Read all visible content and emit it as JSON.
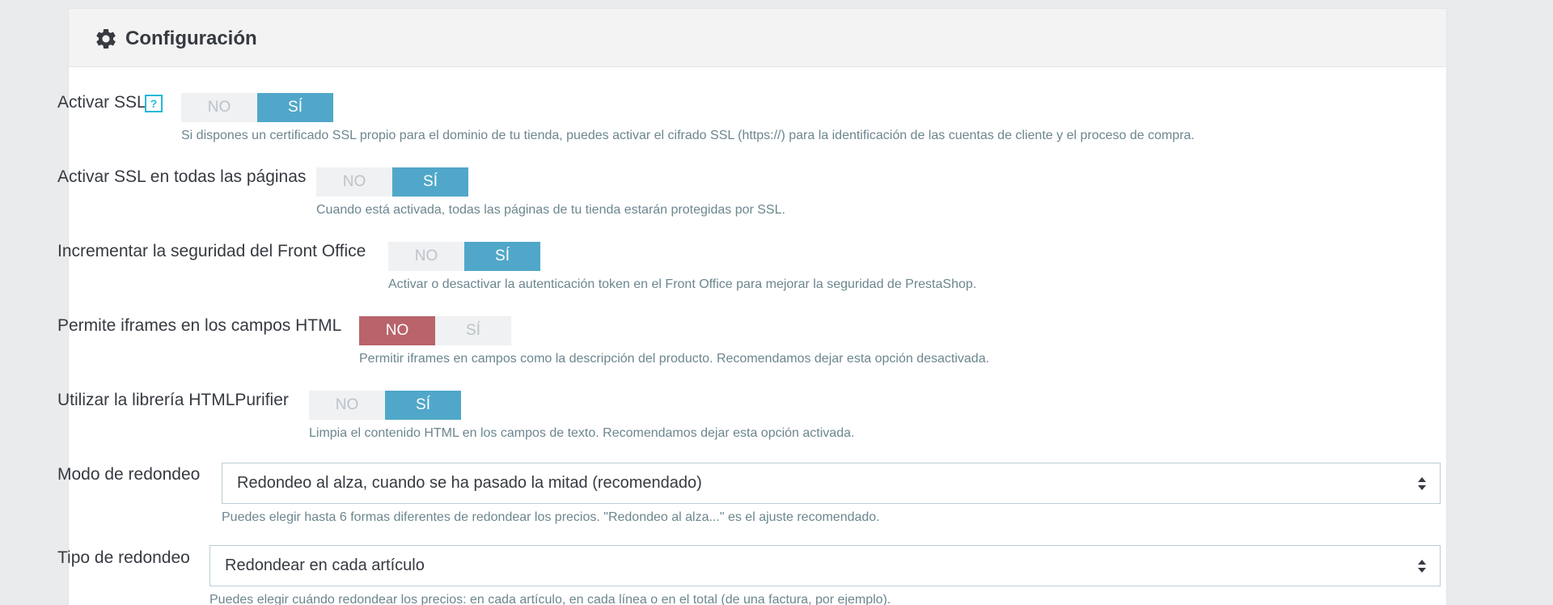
{
  "panel": {
    "title": "Configuración",
    "icon": "gear-icon"
  },
  "switch_labels": {
    "no": "NO",
    "yes": "SÍ"
  },
  "settings": [
    {
      "label": "Activar SSL",
      "has_help": true,
      "help_icon_text": "?",
      "value": "yes",
      "help": "Si dispones un certificado SSL propio para el dominio de tu tienda, puedes activar el cifrado SSL (https://) para la identificación de las cuentas de cliente y el proceso de compra."
    },
    {
      "label": "Activar SSL en todas las páginas",
      "value": "yes",
      "help": "Cuando está activada, todas las páginas de tu tienda estarán protegidas por SSL."
    },
    {
      "label": "Incrementar la seguridad del Front Office",
      "value": "yes",
      "help": "Activar o desactivar la autenticación token en el Front Office para mejorar la seguridad de PrestaShop."
    },
    {
      "label": "Permite iframes en los campos HTML",
      "value": "no",
      "help": "Permitir iframes en campos como la descripción del producto. Recomendamos dejar esta opción desactivada."
    },
    {
      "label": "Utilizar la librería HTMLPurifier",
      "value": "yes",
      "help": "Limpia el contenido HTML en los campos de texto. Recomendamos dejar esta opción activada."
    }
  ],
  "selects": [
    {
      "label": "Modo de redondeo",
      "value": "Redondeo al alza, cuando se ha pasado la mitad (recomendado)",
      "help": "Puedes elegir hasta 6 formas diferentes de redondear los precios. \"Redondeo al alza...\" es el ajuste recomendado."
    },
    {
      "label": "Tipo de redondeo",
      "value": "Redondear en cada artículo",
      "help": "Puedes elegir cuándo redondear los precios: en cada artículo, en cada línea o en el total (de una factura, por ejemplo)."
    }
  ],
  "colors": {
    "yes_active": "#50a7c9",
    "no_active": "#b9636a",
    "inactive": "#eff1f2",
    "help_text": "#6c868e"
  }
}
